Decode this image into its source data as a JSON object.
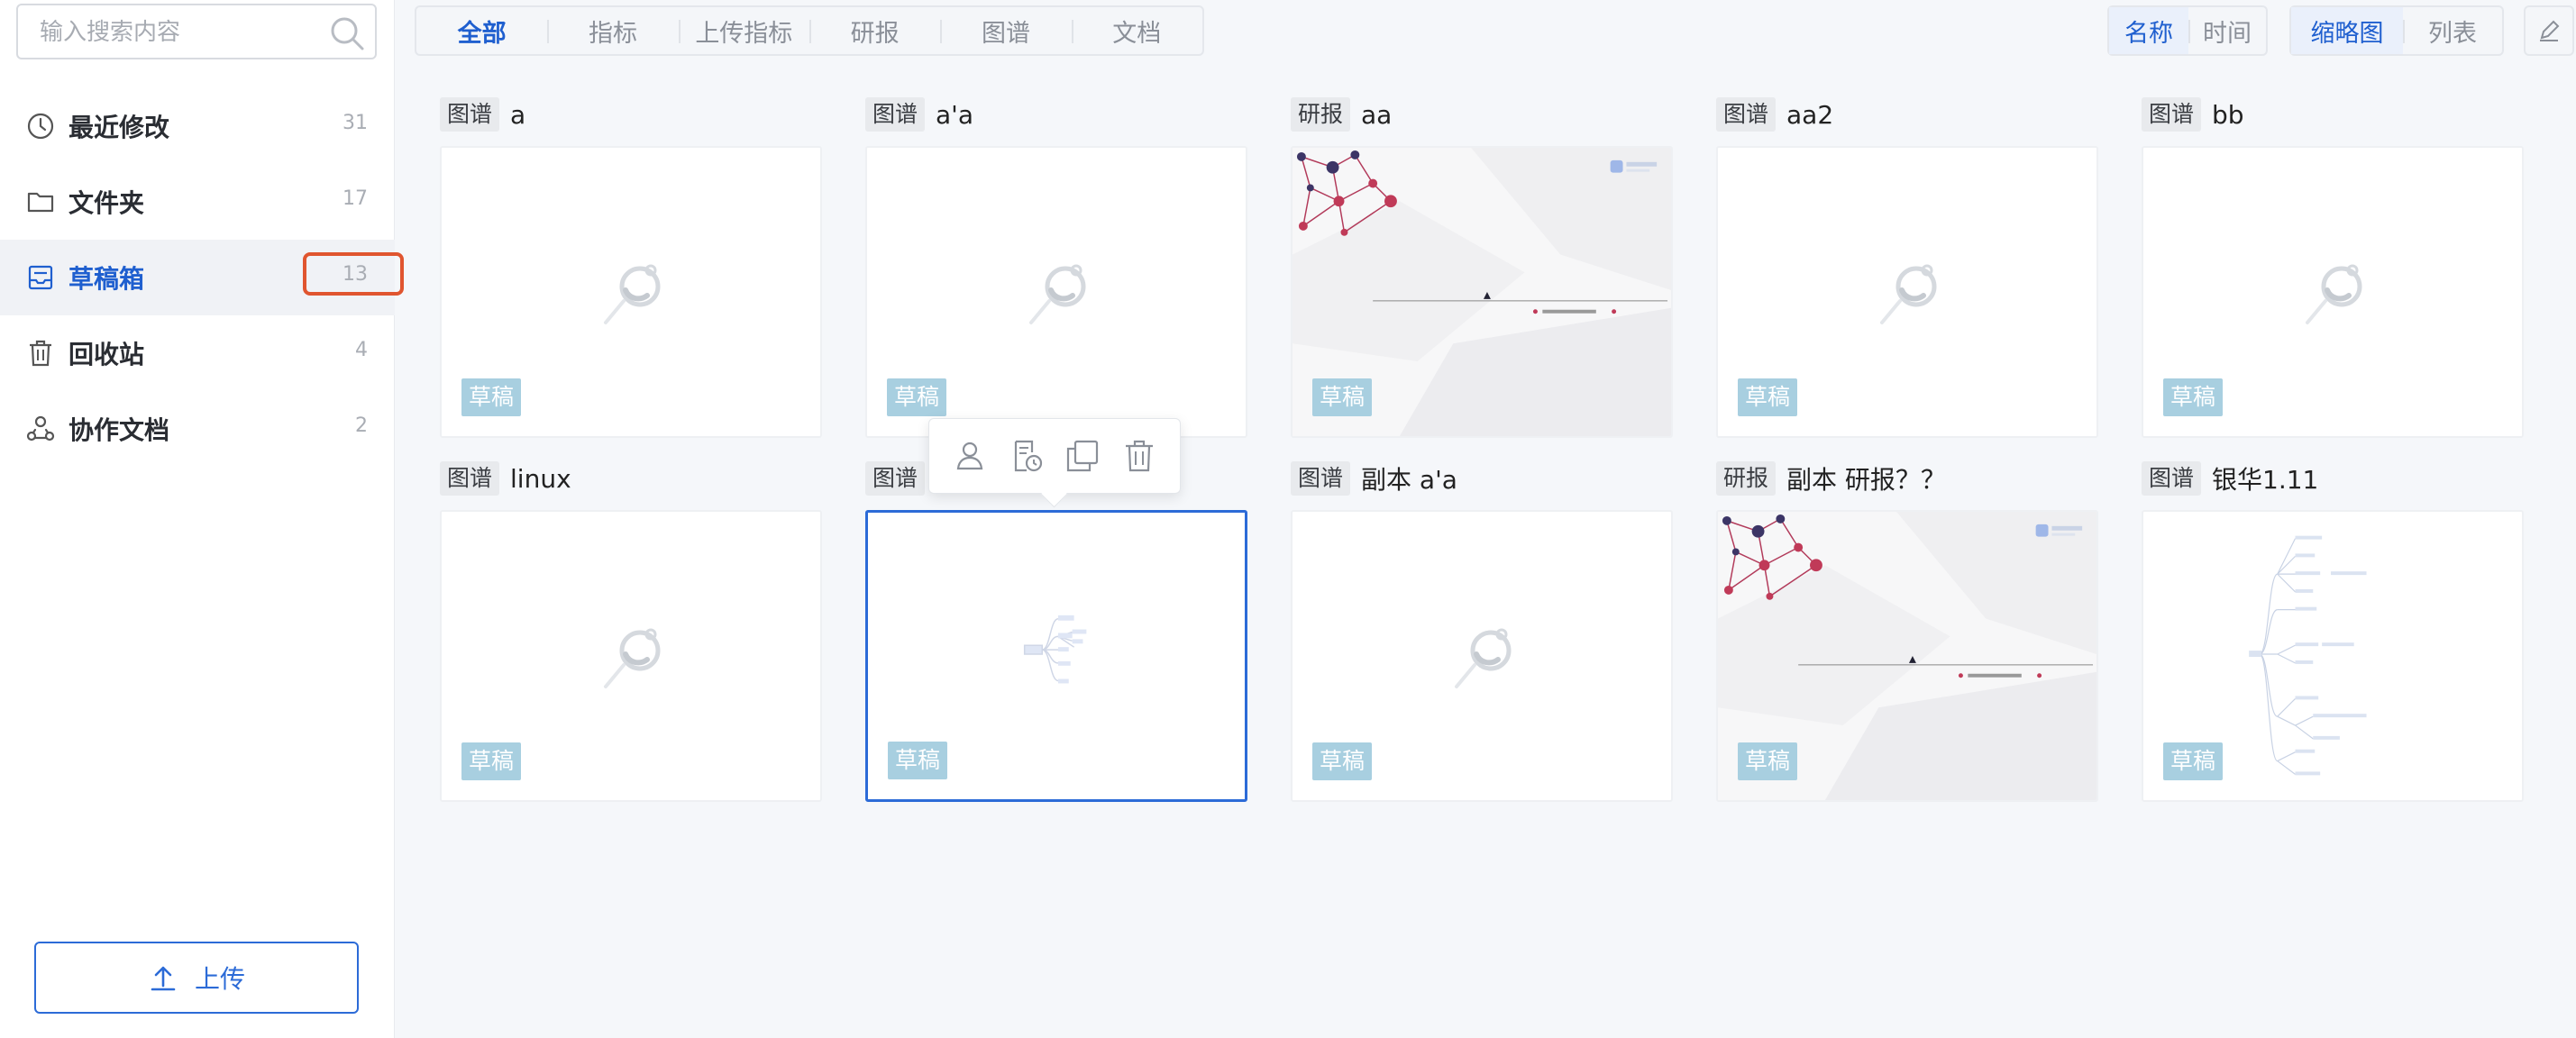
{
  "search": {
    "placeholder": "输入搜索内容"
  },
  "sidebar": {
    "items": [
      {
        "label": "最近修改",
        "count": "31",
        "icon": "clock-icon"
      },
      {
        "label": "文件夹",
        "count": "17",
        "icon": "folder-icon"
      },
      {
        "label": "草稿箱",
        "count": "13",
        "icon": "draft-box-icon",
        "active": true
      },
      {
        "label": "回收站",
        "count": "4",
        "icon": "trash-icon"
      },
      {
        "label": "协作文档",
        "count": "2",
        "icon": "collaborate-icon"
      }
    ],
    "upload_label": "上传"
  },
  "tabs": [
    "全部",
    "指标",
    "上传指标",
    "研报",
    "图谱",
    "文档"
  ],
  "active_tab": "全部",
  "sort": {
    "options": [
      "名称",
      "时间"
    ],
    "active": "名称"
  },
  "view": {
    "options": [
      "缩略图",
      "列表"
    ],
    "active": "缩略图"
  },
  "draft_label": "草稿",
  "cards": [
    {
      "tag": "图谱",
      "name": "a",
      "thumb": "placeholder"
    },
    {
      "tag": "图谱",
      "name": "a'a",
      "thumb": "placeholder"
    },
    {
      "tag": "研报",
      "name": "aa",
      "thumb": "slide"
    },
    {
      "tag": "图谱",
      "name": "aa2",
      "thumb": "placeholder"
    },
    {
      "tag": "图谱",
      "name": "bb",
      "thumb": "placeholder"
    },
    {
      "tag": "图谱",
      "name": "linux",
      "thumb": "placeholder"
    },
    {
      "tag": "图谱",
      "name": "",
      "thumb": "mindmap-small",
      "selected": true
    },
    {
      "tag": "图谱",
      "name": "副本 a'a",
      "thumb": "placeholder"
    },
    {
      "tag": "研报",
      "name": "副本 研报？？",
      "thumb": "slide"
    },
    {
      "tag": "图谱",
      "name": "银华1.11",
      "thumb": "mindmap-large"
    }
  ],
  "popup_actions": [
    "share-user-icon",
    "history-doc-icon",
    "copy-icon",
    "delete-icon"
  ],
  "colors": {
    "accent": "#1f5fcf",
    "highlight": "#e0552f",
    "draft_badge": "#a8cfe0"
  }
}
